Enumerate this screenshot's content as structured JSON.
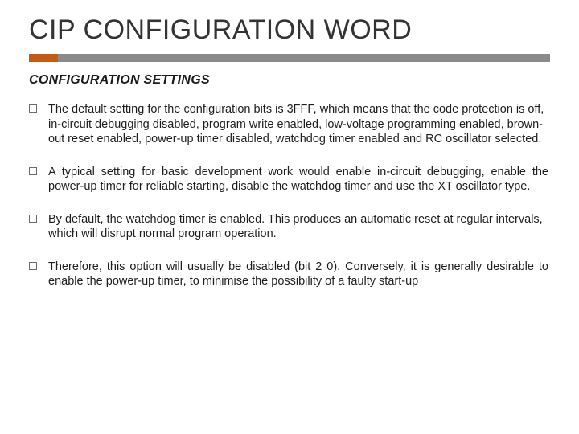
{
  "title": "CIP CONFIGURATION WORD",
  "subheading": "CONFIGURATION SETTINGS",
  "bullets": [
    "The default setting for the configuration bits is 3FFF, which means that the code protection is off, in-circuit debugging disabled, program write enabled, low-voltage programming enabled, brown-out reset enabled, power-up timer disabled, watchdog timer enabled and RC oscillator selected.",
    "A typical setting for basic development work would enable in-circuit debugging, enable the power-up timer for reliable starting, disable the watchdog timer and use the XT oscillator type.",
    "By default, the watchdog timer is enabled. This produces an automatic reset at regular intervals, which will disrupt normal program operation.",
    "Therefore, this option will usually be disabled (bit 2  0). Conversely, it is generally desirable to enable the power-up timer, to minimise the possibility of a faulty start-up"
  ],
  "justify_flags": [
    false,
    true,
    false,
    true
  ],
  "colors": {
    "accent": "#c55a11",
    "bar": "#8a8a8a",
    "box": "#6b6b6b"
  }
}
